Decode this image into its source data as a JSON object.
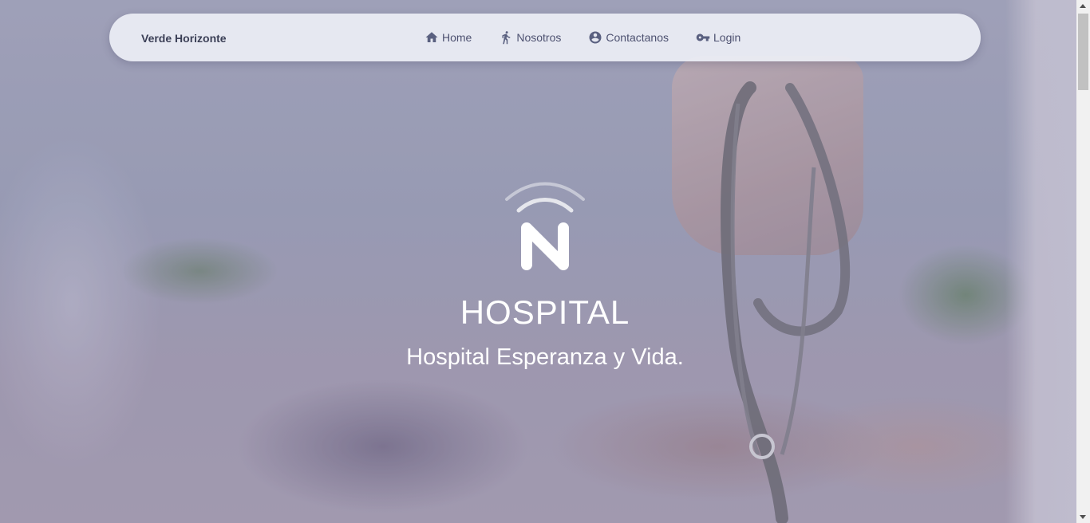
{
  "navbar": {
    "brand": "Verde Horizonte",
    "items": [
      {
        "label": "Home",
        "icon": "home-icon"
      },
      {
        "label": "Nosotros",
        "icon": "running-person-icon"
      },
      {
        "label": "Contactanos",
        "icon": "account-circle-icon"
      },
      {
        "label": "Login",
        "icon": "key-icon"
      }
    ]
  },
  "hero": {
    "logo_letter": "N",
    "title": "HOSPITAL",
    "subtitle": "Hospital Esperanza y Vida."
  },
  "colors": {
    "nav_text": "#4d5170",
    "brand_text": "#3b3f56",
    "hero_text": "#ffffff",
    "navbar_bg": "#eceef5"
  }
}
